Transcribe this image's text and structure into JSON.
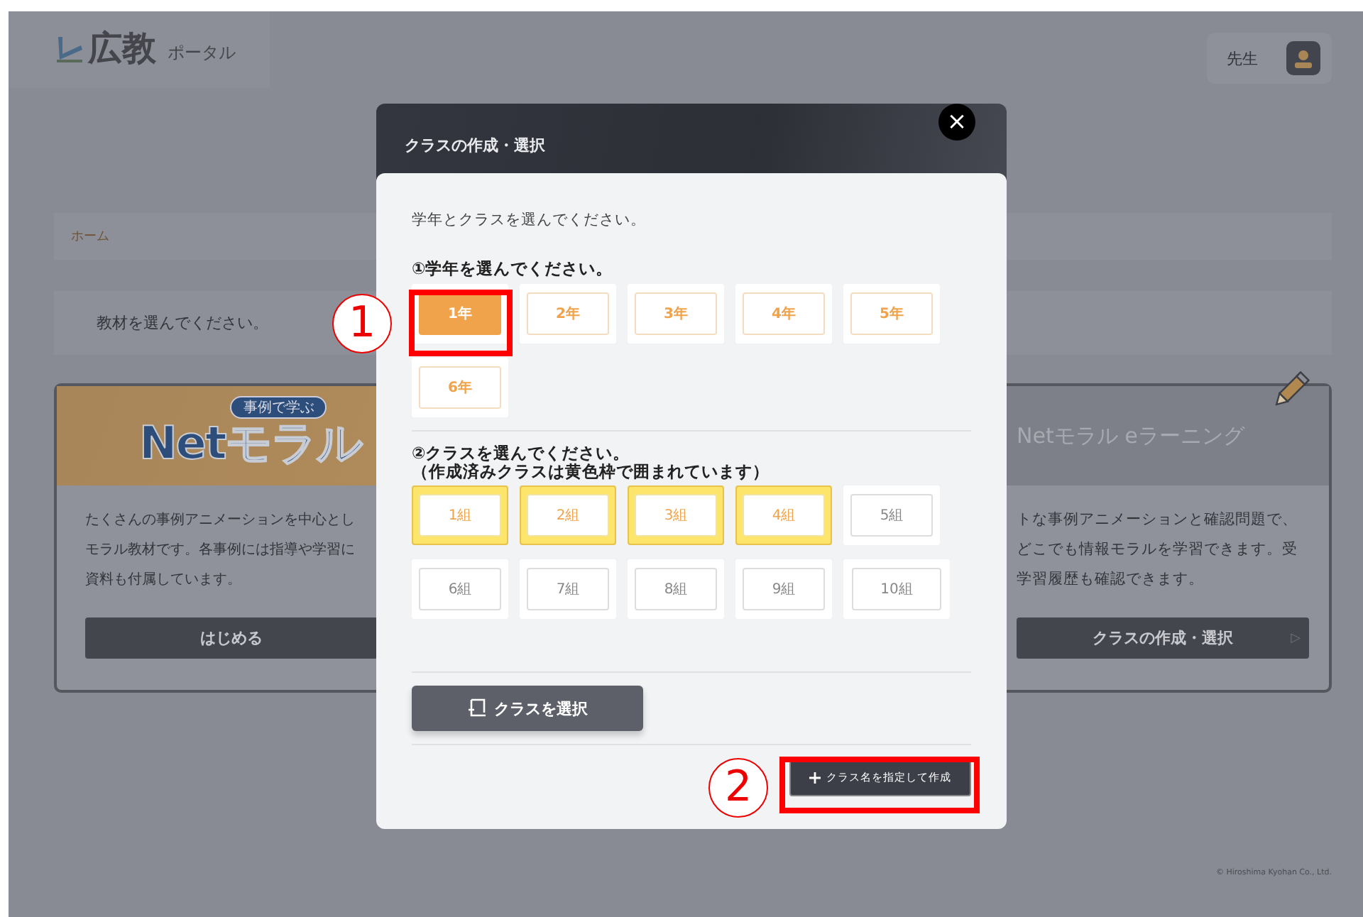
{
  "header": {
    "logo": "広教",
    "logo_sub": "ポータル",
    "user": "先生"
  },
  "breadcrumb": [
    "ホーム"
  ],
  "instruction": "教材を選んでください。",
  "cards": [
    {
      "kind": "logo",
      "badge": "事例で学ぶ",
      "logo": "Netモラル",
      "lines": [
        "たくさんの事例アニメーションを中心とし",
        "モラル教材です。各事例には指導や学習に",
        "資料も付属しています。"
      ],
      "button": "はじめる"
    },
    {
      "kind": "title",
      "title": "Netモラル eラーニング",
      "lines": [
        "トな事例アニメーションと確認問題で、",
        "どこでも情報モラルを学習できます。受",
        "学習履歴も確認できます。"
      ],
      "button": "クラスの作成・選択",
      "button_arrow": "▷"
    }
  ],
  "footer": "© Hiroshima Kyohan Co., Ltd.",
  "modal": {
    "title": "クラスの作成・選択",
    "close": "×",
    "intro": "学年とクラスを選んでください。",
    "grade_heading": "①学年を選んでください。",
    "grades": [
      {
        "label": "1年",
        "selected": true
      },
      {
        "label": "2年",
        "selected": false
      },
      {
        "label": "3年",
        "selected": false
      },
      {
        "label": "4年",
        "selected": false
      },
      {
        "label": "5年",
        "selected": false
      },
      {
        "label": "6年",
        "selected": false
      }
    ],
    "class_heading": [
      "②クラスを選んでください。",
      "（作成済みクラスは黄色枠で囲まれています）"
    ],
    "classes": [
      {
        "label": "1組",
        "created": true
      },
      {
        "label": "2組",
        "created": true
      },
      {
        "label": "3組",
        "created": true
      },
      {
        "label": "4組",
        "created": true
      },
      {
        "label": "5組",
        "created": false
      },
      {
        "label": "6組",
        "created": false
      },
      {
        "label": "7組",
        "created": false
      },
      {
        "label": "8組",
        "created": false
      },
      {
        "label": "9組",
        "created": false
      },
      {
        "label": "10組",
        "created": false
      }
    ],
    "select_button": "クラスを選択",
    "create_button": "クラス名を指定して作成"
  },
  "annotations": [
    {
      "label": "1"
    },
    {
      "label": "2"
    }
  ]
}
